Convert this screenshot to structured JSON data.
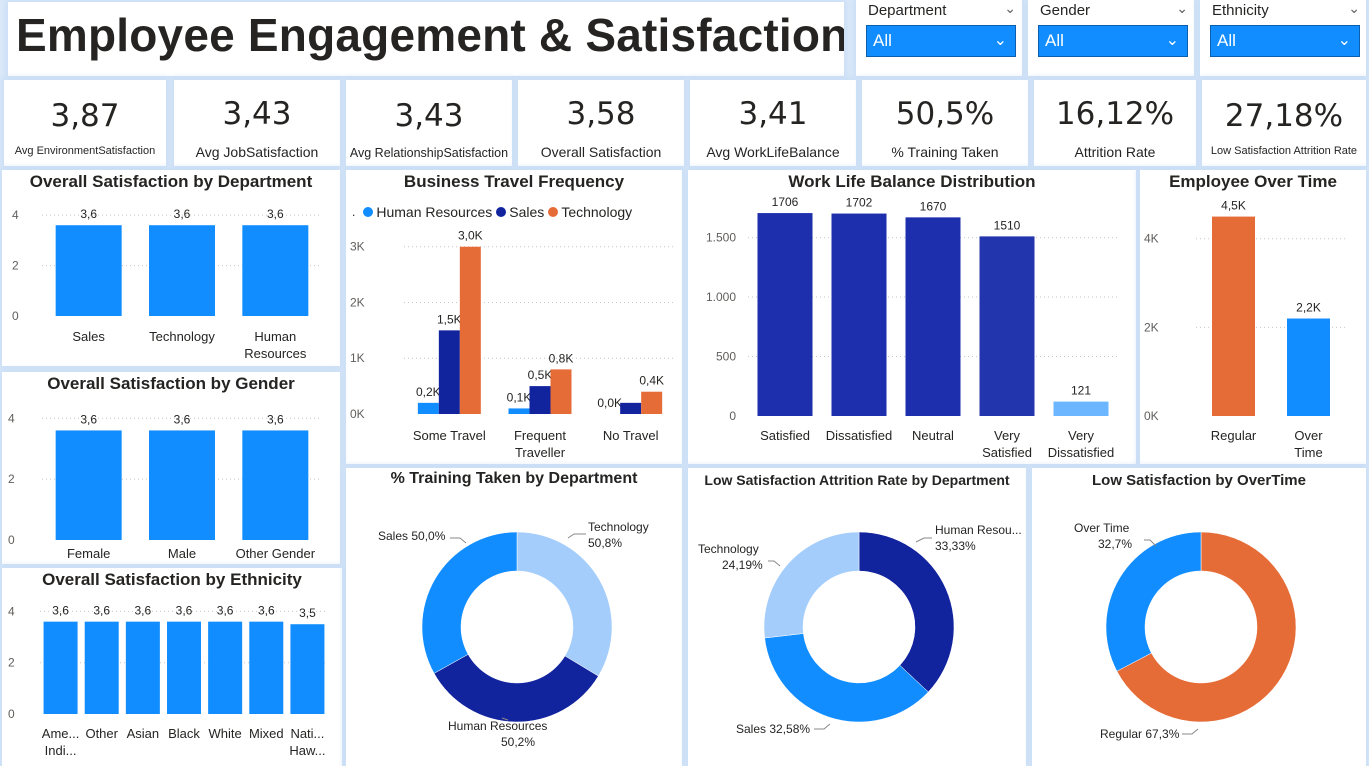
{
  "header": {
    "title": "Employee Engagement & Satisfaction"
  },
  "slicers": [
    {
      "label": "Department",
      "value": "All"
    },
    {
      "label": "Gender",
      "value": "All"
    },
    {
      "label": "Ethnicity",
      "value": "All"
    }
  ],
  "kpis": [
    {
      "value": "3,87",
      "label": "Avg EnvironmentSatisfaction"
    },
    {
      "value": "3,43",
      "label": "Avg JobSatisfaction"
    },
    {
      "value": "3,43",
      "label": "Avg RelationshipSatisfaction"
    },
    {
      "value": "3,58",
      "label": "Overall Satisfaction"
    },
    {
      "value": "3,41",
      "label": "Avg WorkLifeBalance"
    },
    {
      "value": "50,5%",
      "label": "% Training Taken"
    },
    {
      "value": "16,12%",
      "label": "Attrition Rate"
    },
    {
      "value": "27,18%",
      "label": "Low Satisfaction Attrition Rate"
    }
  ],
  "colors": {
    "blue": "#118dff",
    "navy": "#12239e",
    "orange": "#e66c37",
    "light_blue": "#a4cdfb",
    "dark_blue": "#1e2fae",
    "pale_blue": "#6cb5ff",
    "axis_text": "#605e5c"
  },
  "chart_data": [
    {
      "id": "dept",
      "type": "bar",
      "title": "Overall Satisfaction by Department",
      "categories": [
        "Sales",
        "Technology",
        "Human Resources"
      ],
      "category_lines": [
        [
          "Sales"
        ],
        [
          "Technology"
        ],
        [
          "Human",
          "Resources"
        ]
      ],
      "values": [
        3.6,
        3.6,
        3.6
      ],
      "value_labels": [
        "3,6",
        "3,6",
        "3,6"
      ],
      "yticks": [
        "0",
        "2",
        "4"
      ],
      "ylim": [
        0,
        4.6
      ]
    },
    {
      "id": "gender",
      "type": "bar",
      "title": "Overall Satisfaction by Gender",
      "categories": [
        "Female",
        "Male",
        "Other Gender"
      ],
      "category_lines": [
        [
          "Female"
        ],
        [
          "Male"
        ],
        [
          "Other Gender"
        ]
      ],
      "values": [
        3.6,
        3.6,
        3.6
      ],
      "value_labels": [
        "3,6",
        "3,6",
        "3,6"
      ],
      "yticks": [
        "0",
        "2",
        "4"
      ],
      "ylim": [
        0,
        4.6
      ]
    },
    {
      "id": "ethnicity",
      "type": "bar",
      "title": "Overall Satisfaction by Ethnicity",
      "categories": [
        "Ame... Indi...",
        "Other",
        "Asian",
        "Black",
        "White",
        "Mixed",
        "Nati... Haw..."
      ],
      "category_lines": [
        [
          "Ame...",
          "Indi..."
        ],
        [
          "Other"
        ],
        [
          "Asian"
        ],
        [
          "Black"
        ],
        [
          "White"
        ],
        [
          "Mixed"
        ],
        [
          "Nati...",
          "Haw..."
        ]
      ],
      "values": [
        3.6,
        3.6,
        3.6,
        3.6,
        3.6,
        3.6,
        3.5
      ],
      "value_labels": [
        "3,6",
        "3,6",
        "3,6",
        "3,6",
        "3,6",
        "3,6",
        "3,5"
      ],
      "yticks": [
        "0",
        "2",
        "4"
      ],
      "ylim": [
        0,
        4.6
      ]
    },
    {
      "id": "travel",
      "type": "bar",
      "title": "Business Travel Frequency",
      "legend_marker": ".",
      "categories": [
        "Some Travel",
        "Frequent Traveller",
        "No Travel"
      ],
      "category_lines": [
        [
          "Some Travel"
        ],
        [
          "Frequent",
          "Traveller"
        ],
        [
          "No Travel"
        ]
      ],
      "series": [
        {
          "name": "Human Resources",
          "values": [
            200,
            100,
            0
          ],
          "value_labels": [
            "0,2K",
            "0,1K",
            "0,0K"
          ]
        },
        {
          "name": "Sales",
          "values": [
            1500,
            500,
            200
          ],
          "value_labels": [
            "1,5K",
            "0,5K",
            ""
          ]
        },
        {
          "name": "Technology",
          "values": [
            3000,
            800,
            400
          ],
          "value_labels": [
            "3,0K",
            "0,8K",
            "0,4K"
          ]
        }
      ],
      "yticks": [
        "0K",
        "1K",
        "2K",
        "3K"
      ],
      "ylim": [
        0,
        3300
      ]
    },
    {
      "id": "wlb",
      "type": "bar",
      "title": "Work Life Balance Distribution",
      "categories": [
        "Satisfied",
        "Dissatisfied",
        "Neutral",
        "Very Satisfied",
        "Very Dissatisfied"
      ],
      "category_lines": [
        [
          "Satisfied"
        ],
        [
          "Dissatisfied"
        ],
        [
          "Neutral"
        ],
        [
          "Very",
          "Satisfied"
        ],
        [
          "Very",
          "Dissatisfied"
        ]
      ],
      "values": [
        1706,
        1702,
        1670,
        1510,
        121
      ],
      "value_labels": [
        "1706",
        "1702",
        "1670",
        "1510",
        "121"
      ],
      "yticks": [
        "0",
        "500",
        "1.000",
        "1.500"
      ],
      "ylim": [
        0,
        1900
      ]
    },
    {
      "id": "overtime",
      "type": "bar",
      "title": "Employee Over Time",
      "categories": [
        "Regular",
        "Over Time"
      ],
      "category_lines": [
        [
          "Regular"
        ],
        [
          "Over",
          "Time"
        ]
      ],
      "values": [
        4500,
        2200
      ],
      "value_labels": [
        "4,5K",
        "2,2K"
      ],
      "yticks": [
        "0K",
        "2K",
        "4K"
      ],
      "ylim": [
        0,
        5100
      ]
    },
    {
      "id": "training",
      "type": "pie",
      "title": "% Training Taken by Department",
      "slices": [
        {
          "label": "Technology",
          "value": 50.8,
          "value_label": "50,8%"
        },
        {
          "label": "Human Resources",
          "value": 50.2,
          "value_label": "50,2%"
        },
        {
          "label": "Sales",
          "value": 50.0,
          "value_label": "50,0%"
        }
      ]
    },
    {
      "id": "lowsat",
      "type": "pie",
      "title": "Low Satisfaction Attrition Rate by Department",
      "slices": [
        {
          "label": "Human Resou...",
          "value": 33.33,
          "value_label": "33,33%"
        },
        {
          "label": "Sales",
          "value": 32.58,
          "value_label": "32,58%"
        },
        {
          "label": "Technology",
          "value": 24.19,
          "value_label": "24,19%"
        }
      ]
    },
    {
      "id": "lowsat_ot",
      "type": "pie",
      "title": "Low Satisfaction by OverTime",
      "slices": [
        {
          "label": "Regular",
          "value": 67.3,
          "value_label": "67,3%"
        },
        {
          "label": "Over Time",
          "value": 32.7,
          "value_label": "32,7%"
        }
      ]
    }
  ]
}
